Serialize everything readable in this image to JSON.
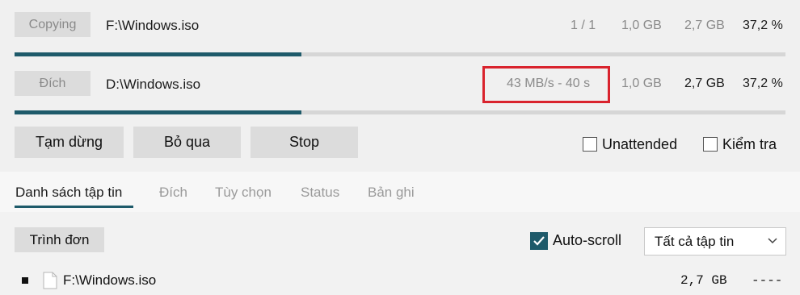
{
  "copying": {
    "status_label": "Copying",
    "path": "F:\\Windows.iso",
    "count": "1 / 1",
    "copied": "1,0 GB",
    "total": "2,7 GB",
    "percent": "37,2 %",
    "progress": 0.372
  },
  "destination": {
    "label": "Đích",
    "path": "D:\\Windows.iso",
    "speed": "43 MB/s - 40 s",
    "copied": "1,0 GB",
    "total": "2,7 GB",
    "percent": "37,2 %",
    "progress": 0.372,
    "highlight_color": "#d9232d"
  },
  "actions": {
    "pause": "Tạm dừng",
    "skip": "Bỏ qua",
    "stop": "Stop",
    "unattended": "Unattended",
    "verify": "Kiểm tra"
  },
  "tabs": [
    {
      "label": "Danh sách tập tin",
      "active": true
    },
    {
      "label": "Đích"
    },
    {
      "label": "Tùy chọn"
    },
    {
      "label": "Status"
    },
    {
      "label": "Bản ghi"
    }
  ],
  "file_panel": {
    "menu_label": "Trình đơn",
    "autoscroll_label": "Auto-scroll",
    "autoscroll_checked": true,
    "filter_value": "Tất cả tập tin",
    "files": [
      {
        "name": "F:\\Windows.iso",
        "size": "2,7 GB",
        "status": "----"
      }
    ]
  },
  "colors": {
    "accent": "#1e5a6a",
    "check_fill": "#1e5a6a"
  }
}
